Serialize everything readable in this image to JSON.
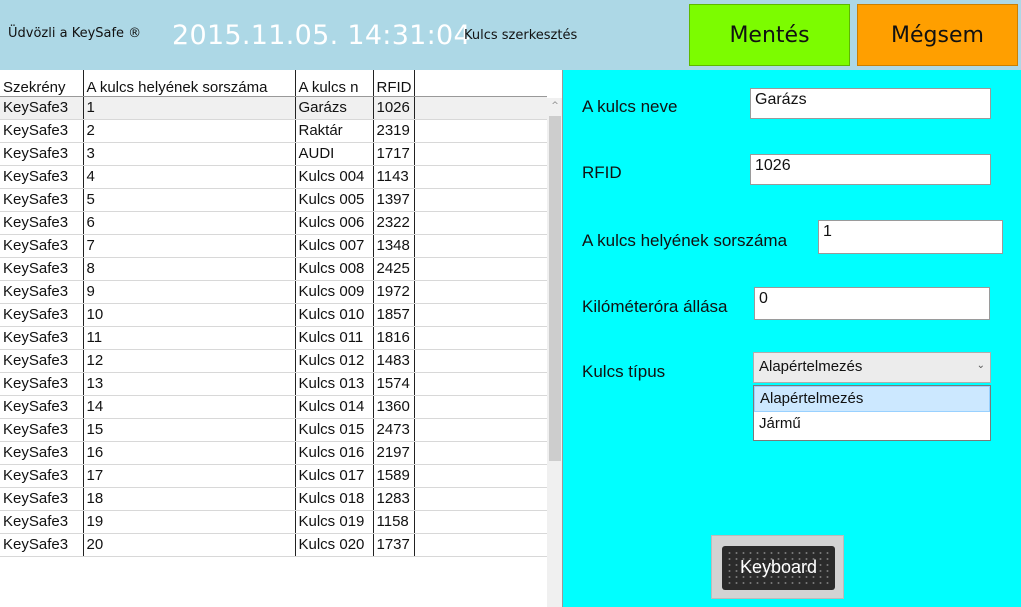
{
  "header": {
    "welcome": "Üdvözli a KeySafe ®",
    "datetime": "2015.11.05. 14:31:04",
    "page_title": "Kulcs szerkesztés",
    "save_label": "Mentés",
    "cancel_label": "Mégsem"
  },
  "grid": {
    "columns": [
      "Szekrény",
      "A kulcs helyének sorszáma",
      "A kulcs n",
      "RFID"
    ],
    "rows": [
      [
        "KeySafe3",
        "1",
        "Garázs",
        "1026"
      ],
      [
        "KeySafe3",
        "2",
        "Raktár",
        "2319"
      ],
      [
        "KeySafe3",
        "3",
        "AUDI",
        "1717"
      ],
      [
        "KeySafe3",
        "4",
        "Kulcs 004",
        "1143"
      ],
      [
        "KeySafe3",
        "5",
        "Kulcs 005",
        "1397"
      ],
      [
        "KeySafe3",
        "6",
        "Kulcs 006",
        "2322"
      ],
      [
        "KeySafe3",
        "7",
        "Kulcs 007",
        "1348"
      ],
      [
        "KeySafe3",
        "8",
        "Kulcs 008",
        "2425"
      ],
      [
        "KeySafe3",
        "9",
        "Kulcs 009",
        "1972"
      ],
      [
        "KeySafe3",
        "10",
        "Kulcs 010",
        "1857"
      ],
      [
        "KeySafe3",
        "11",
        "Kulcs 011",
        "1816"
      ],
      [
        "KeySafe3",
        "12",
        "Kulcs 012",
        "1483"
      ],
      [
        "KeySafe3",
        "13",
        "Kulcs 013",
        "1574"
      ],
      [
        "KeySafe3",
        "14",
        "Kulcs 014",
        "1360"
      ],
      [
        "KeySafe3",
        "15",
        "Kulcs 015",
        "2473"
      ],
      [
        "KeySafe3",
        "16",
        "Kulcs 016",
        "2197"
      ],
      [
        "KeySafe3",
        "17",
        "Kulcs 017",
        "1589"
      ],
      [
        "KeySafe3",
        "18",
        "Kulcs 018",
        "1283"
      ],
      [
        "KeySafe3",
        "19",
        "Kulcs 019",
        "1158"
      ],
      [
        "KeySafe3",
        "20",
        "Kulcs 020",
        "1737"
      ]
    ]
  },
  "form": {
    "name_label": "A kulcs neve",
    "name_value": "Garázs",
    "rfid_label": "RFID",
    "rfid_value": "1026",
    "slot_label": "A kulcs helyének sorszáma",
    "slot_value": "1",
    "km_label": "Kilóméteróra állása",
    "km_value": "0",
    "type_label": "Kulcs típus",
    "type_selected": "Alapértelmezés",
    "type_options": [
      "Alapértelmezés",
      "Jármű"
    ],
    "keyboard_label": "Keyboard"
  },
  "colors": {
    "header_bg": "#add8e6",
    "save_bg": "#7cfc00",
    "cancel_bg": "#ff9f00",
    "panel_bg": "#00ffff"
  }
}
